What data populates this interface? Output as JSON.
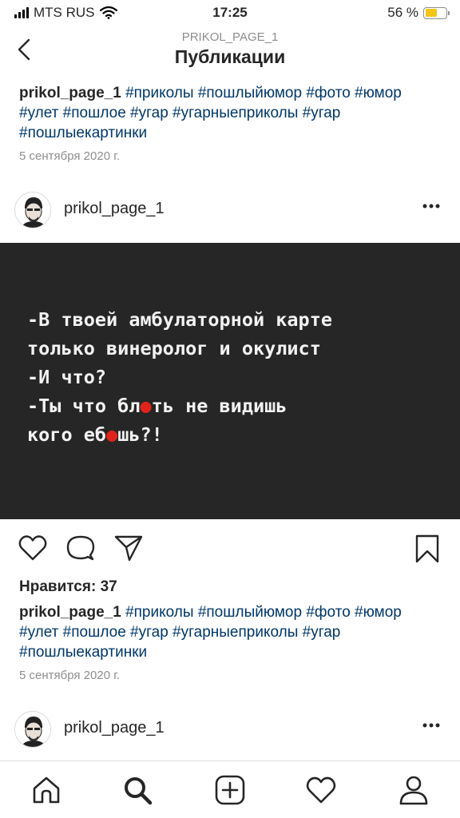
{
  "status_bar": {
    "carrier": "MTS RUS",
    "time": "17:25",
    "battery_percent": "56 %",
    "battery_level": 0.56
  },
  "nav": {
    "subtitle": "PRIKOL_PAGE_1",
    "title": "Публикации"
  },
  "previous_post": {
    "username": "prikol_page_1",
    "hashtags": [
      "#приколы",
      "#пошлыйюмор",
      "#фото",
      "#юмор",
      "#улет",
      "#пошлое",
      "#угар",
      "#угарныеприколы",
      "#угар",
      "#пошлыекартинки"
    ],
    "date": "5 сентября 2020 г."
  },
  "post": {
    "username": "prikol_page_1",
    "image_text": [
      "-В твоей амбулаторной карте",
      "только винеролог и окулист",
      "-И что?",
      "-Ты что бл",
      "ть не видишь",
      "кого еб",
      "шь?!"
    ],
    "likes": "Нравится: 37",
    "caption_username": "prikol_page_1",
    "hashtags": [
      "#приколы",
      "#пошлыйюмор",
      "#фото",
      "#юмор",
      "#улет",
      "#пошлое",
      "#угар",
      "#угарныеприколы",
      "#угар",
      "#пошлыекартинки"
    ],
    "date": "5 сентября 2020 г."
  },
  "next_post": {
    "username": "prikol_page_1"
  },
  "icons": {
    "back": "chevron-left-icon",
    "more": "more-dots-icon",
    "like": "heart-icon",
    "comment": "comment-bubble-icon",
    "share": "paper-plane-icon",
    "save": "bookmark-icon",
    "home": "home-icon",
    "search": "search-icon",
    "new_post": "plus-square-icon",
    "activity": "heart-icon",
    "profile": "person-icon"
  },
  "colors": {
    "text": "#262626",
    "hashtag": "#00376b",
    "muted": "#8e8e8e",
    "image_bg": "#262626",
    "censor_dot": "#e0241b",
    "battery": "#f5c518"
  }
}
